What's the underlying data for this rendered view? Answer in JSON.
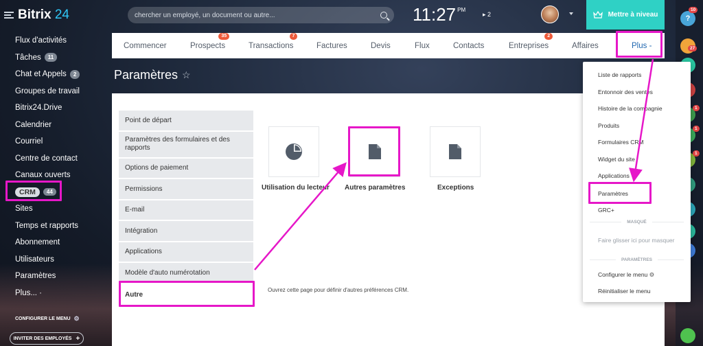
{
  "app": {
    "logo_main": "Bitrix",
    "logo_num": "24"
  },
  "sidebar": {
    "items": [
      {
        "label": "Flux d'activités",
        "badge": ""
      },
      {
        "label": "Tâches",
        "badge": "11"
      },
      {
        "label": "Chat et Appels",
        "badge": "2"
      },
      {
        "label": "Groupes de travail",
        "badge": ""
      },
      {
        "label": "Bitrix24.Drive",
        "badge": ""
      },
      {
        "label": "Calendrier",
        "badge": ""
      },
      {
        "label": "Courriel",
        "badge": ""
      },
      {
        "label": "Centre de contact",
        "badge": ""
      },
      {
        "label": "Canaux ouverts",
        "badge": ""
      },
      {
        "label": "CRM",
        "badge": "44"
      },
      {
        "label": "Sites",
        "badge": ""
      },
      {
        "label": "Temps et rapports",
        "badge": ""
      },
      {
        "label": "Abonnement",
        "badge": ""
      },
      {
        "label": "Utilisateurs",
        "badge": ""
      },
      {
        "label": "Paramètres",
        "badge": ""
      },
      {
        "label": "Plus... ·",
        "badge": ""
      }
    ],
    "configure_label": "CONFIGURER LE MENU",
    "invite_label": "INVITER DES EMPLOYÉS"
  },
  "header": {
    "search_placeholder": "chercher un employé, un document ou autre...",
    "time": "11:27",
    "ampm": "PM",
    "tasks_count": "2",
    "upgrade_label": "Mettre à niveau"
  },
  "tabs": [
    {
      "label": "Commencer",
      "badge": ""
    },
    {
      "label": "Prospects",
      "badge": "35"
    },
    {
      "label": "Transactions",
      "badge": "7"
    },
    {
      "label": "Factures",
      "badge": ""
    },
    {
      "label": "Devis",
      "badge": ""
    },
    {
      "label": "Flux",
      "badge": ""
    },
    {
      "label": "Contacts",
      "badge": ""
    },
    {
      "label": "Entreprises",
      "badge": "2"
    },
    {
      "label": "Affaires",
      "badge": ""
    },
    {
      "label": "Plus -",
      "badge": ""
    }
  ],
  "page": {
    "title": "Paramètres",
    "star": "☆"
  },
  "settings_menu": [
    "Point de départ",
    "Paramètres des formulaires et des rapports",
    "Options de paiement",
    "Permissions",
    "E-mail",
    "Intégration",
    "Applications",
    "Modèle d'auto numérotation",
    "Autre"
  ],
  "tiles": [
    {
      "label": "Utilisation du lecteur",
      "icon": "pie-chart-icon"
    },
    {
      "label": "Autres paramètres",
      "icon": "document-icon"
    },
    {
      "label": "Exceptions",
      "icon": "document-icon"
    }
  ],
  "description": "Ouvrez cette page pour définir d'autres préférences CRM.",
  "dropdown": {
    "items": [
      "Liste de rapports",
      "Entonnoir des ventes",
      "Histoire de la compagnie",
      "Produits",
      "Formulaires CRM",
      "Widget du site",
      "Applications",
      "Paramètres",
      "GRC+"
    ],
    "hidden_header": "MASQUÉ",
    "drop_hint": "Faire glisser ici pour masquer",
    "settings_header": "PARAMÈTRES",
    "configure_label": "Configurer le menu",
    "reset_label": "Réinitialiser le menu"
  },
  "right_panel": {
    "badges": [
      "10",
      "27",
      "1",
      "1",
      "1"
    ],
    "digit": "4"
  },
  "colors": {
    "accent": "#2fd1c5",
    "highlight": "#e617c8",
    "link": "#2067b0",
    "badge_red": "#ee5a3a"
  }
}
